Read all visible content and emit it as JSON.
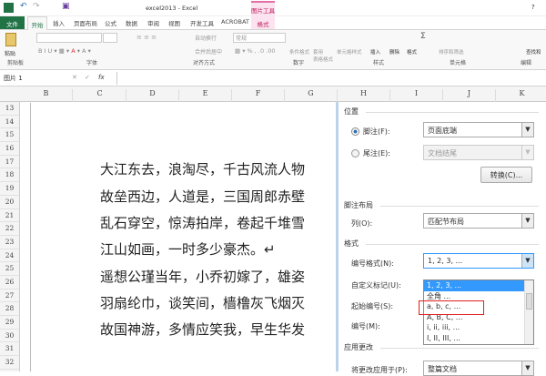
{
  "window": {
    "title": "excel2013 - Excel",
    "context_tab_group": "图片工具",
    "help": "?"
  },
  "tabs": [
    {
      "label": "文件"
    },
    {
      "label": "开始"
    },
    {
      "label": "插入"
    },
    {
      "label": "页面布局"
    },
    {
      "label": "公式"
    },
    {
      "label": "数据"
    },
    {
      "label": "审阅"
    },
    {
      "label": "视图"
    },
    {
      "label": "开发工具"
    },
    {
      "label": "ACROBAT"
    },
    {
      "label": "格式"
    }
  ],
  "ribbon": {
    "paste": "粘贴",
    "wrap": "自动换行",
    "merge": "合并后居中",
    "number_format": "常规",
    "cond_format": "条件格式",
    "table_format": "套用\n表格格式",
    "cell_style": "单元格样式",
    "insert": "插入",
    "delete": "删除",
    "format": "格式",
    "sort": "排序和筛选",
    "find": "查找和",
    "groups": [
      "剪贴板",
      "字体",
      "对齐方式",
      "数字",
      "样式",
      "单元格",
      "编辑"
    ]
  },
  "formula_bar": {
    "name_box": "图片 1",
    "fx": "fx"
  },
  "columns": [
    "B",
    "C",
    "D",
    "E",
    "F",
    "G",
    "H",
    "I",
    "J",
    "K"
  ],
  "rows": [
    "13",
    "14",
    "15",
    "16",
    "17",
    "18",
    "19",
    "20",
    "21",
    "22",
    "23",
    "24",
    "25",
    "26",
    "27",
    "28",
    "29",
    "30",
    "31",
    "32"
  ],
  "poem": [
    "大江东去，浪淘尽，千古风流人物",
    "故垒西边，人道是，三国周郎赤壁",
    "乱石穿空，惊涛拍岸，卷起千堆雪",
    "江山如画，一时多少豪杰。↵",
    "遥想公瑾当年，小乔初嫁了，雄姿",
    "羽扇纶巾，谈笑间，樯橹灰飞烟灭",
    "故国神游，多情应笑我，早生华发"
  ],
  "dialog": {
    "position_title": "位置",
    "footnote_label": "脚注(F):",
    "footnote_value": "页面底端",
    "endnote_label": "尾注(E):",
    "endnote_value": "文档结尾",
    "convert_button": "转换(C)...",
    "layout_title": "脚注布局",
    "columns_label": "列(O):",
    "columns_value": "匹配节布局",
    "format_title": "格式",
    "number_format_label": "编号格式(N):",
    "number_format_value": "1, 2, 3, ...",
    "custom_mark_label": "自定义标记(U):",
    "start_at_label": "起始编号(S):",
    "numbering_label": "编号(M):",
    "options": [
      "1, 2, 3, ...",
      "全角 ...",
      "a, b, c, ...",
      "A, B, C, ...",
      "i, ii, iii, ...",
      "I, II, III, ..."
    ],
    "selected_index": 0,
    "highlighted_option": "A, B, C, ...",
    "apply_title": "应用更改",
    "apply_to_label": "将更改应用于(P):",
    "apply_to_value": "整篇文档"
  },
  "colors": {
    "file_tab": "#217346",
    "context": "#e46fa6",
    "highlight": "#3399ff",
    "red_box": "#e02020"
  }
}
